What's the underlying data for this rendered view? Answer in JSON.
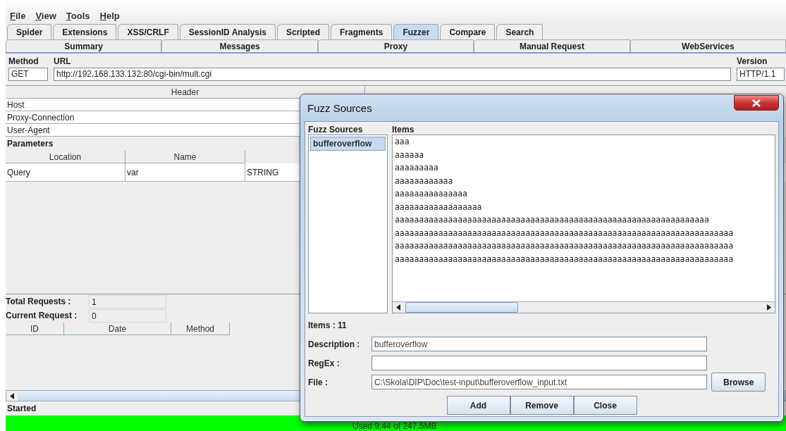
{
  "menu": [
    "File",
    "View",
    "Tools",
    "Help"
  ],
  "tabs": [
    {
      "label": "Spider",
      "selected": false
    },
    {
      "label": "Extensions",
      "selected": false
    },
    {
      "label": "XSS/CRLF",
      "selected": false
    },
    {
      "label": "SessionID Analysis",
      "selected": false
    },
    {
      "label": "Scripted",
      "selected": false
    },
    {
      "label": "Fragments",
      "selected": false
    },
    {
      "label": "Fuzzer",
      "selected": true
    },
    {
      "label": "Compare",
      "selected": false
    },
    {
      "label": "Search",
      "selected": false
    }
  ],
  "subtabs": [
    "Summary",
    "Messages",
    "Proxy",
    "Manual Request",
    "WebServices"
  ],
  "request": {
    "method_label": "Method",
    "method": "GET",
    "url_label": "URL",
    "url": "http://192.168.133.132:80/cgi-bin/mult.cgi",
    "version_label": "Version",
    "version": "HTTP/1.1"
  },
  "headers_table": {
    "columns": [
      "Header"
    ],
    "rows": [
      "Host",
      "Proxy-Connection",
      "User-Agent"
    ]
  },
  "parameters": {
    "title": "Parameters",
    "columns": [
      "Location",
      "Name"
    ],
    "rows": [
      [
        "Query",
        "var",
        "STRING"
      ]
    ]
  },
  "stats": [
    {
      "label": "Total Requests :",
      "value": "1"
    },
    {
      "label": "Current Request :",
      "value": "0"
    }
  ],
  "requests_table": {
    "columns": [
      "ID",
      "Date",
      "Method"
    ]
  },
  "status": "Started",
  "memory": "Used 9.44 of 247.5MB",
  "dialog": {
    "title": "Fuzz Sources",
    "sources_label": "Fuzz Sources",
    "items_label": "Items",
    "sources": [
      {
        "label": "bufferoverflow",
        "selected": true
      }
    ],
    "items": [
      "aaa",
      "aaaaaa",
      "aaaaaaaaa",
      "aaaaaaaaaaaa",
      "aaaaaaaaaaaaaaa",
      "aaaaaaaaaaaaaaaaaa",
      "aaaaaaaaaaaaaaaaaaaaaaaaaaaaaaaaaaaaaaaaaaaaaaaaaaaaaaaaaaaaaaaaa",
      "aaaaaaaaaaaaaaaaaaaaaaaaaaaaaaaaaaaaaaaaaaaaaaaaaaaaaaaaaaaaaaaaaaaaaa",
      "aaaaaaaaaaaaaaaaaaaaaaaaaaaaaaaaaaaaaaaaaaaaaaaaaaaaaaaaaaaaaaaaaaaaaa",
      "aaaaaaaaaaaaaaaaaaaaaaaaaaaaaaaaaaaaaaaaaaaaaaaaaaaaaaaaaaaaaaaaaaaaaa"
    ],
    "count": "Items : 11",
    "fields": [
      {
        "label": "Description :",
        "value": "bufferoverflow"
      },
      {
        "label": "RegEx :"
      },
      {
        "label": "File :",
        "value": "C:\\Skola\\DIP\\Doc\\test-input\\bufferoverflow_input.txt"
      }
    ],
    "browse": "Browse",
    "buttons": [
      "Add",
      "Remove",
      "Close"
    ]
  }
}
